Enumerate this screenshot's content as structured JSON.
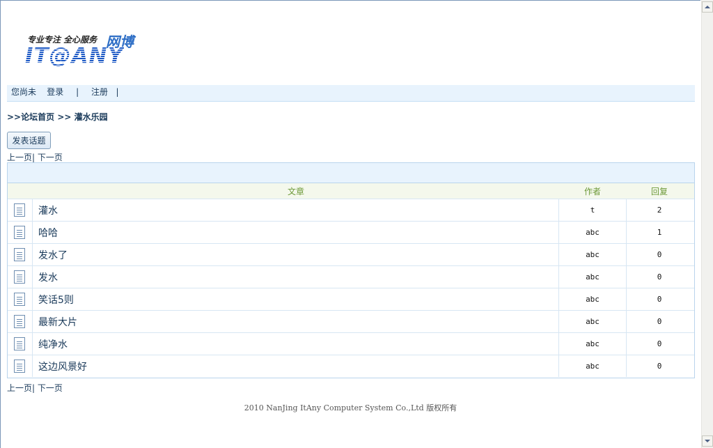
{
  "header": {
    "slogan": "专业专注  全心服务",
    "slogan_brand_cn": "网博",
    "brand": "IT@ANY"
  },
  "userbar": {
    "status": "您尚未",
    "login": "登录",
    "register": "注册"
  },
  "breadcrumb": {
    "home": ">>论坛首页",
    "current": ">> 灌水乐园"
  },
  "toolbar": {
    "post_button": "发表话题"
  },
  "pager": {
    "prev": "上一页",
    "next": "下一页"
  },
  "table": {
    "columns": [
      "文章",
      "作者",
      "回复"
    ],
    "rows": [
      {
        "title": "灌水",
        "author": "t",
        "replies": "2"
      },
      {
        "title": "哈哈",
        "author": "abc",
        "replies": "1"
      },
      {
        "title": "发水了",
        "author": "abc",
        "replies": "0"
      },
      {
        "title": "发水",
        "author": "abc",
        "replies": "0"
      },
      {
        "title": "笑话5则",
        "author": "abc",
        "replies": "0"
      },
      {
        "title": "最新大片",
        "author": "abc",
        "replies": "0"
      },
      {
        "title": "纯净水",
        "author": "abc",
        "replies": "0"
      },
      {
        "title": "这边风景好",
        "author": "abc",
        "replies": "0"
      }
    ]
  },
  "footer": {
    "copyright": "2010 NanJing ItAny Computer System Co.,Ltd 版权所有"
  },
  "colors": {
    "accent": "#1a57c4",
    "header_bg": "#e8f3fd",
    "column_header_text": "#6e9a3a"
  },
  "icons": {
    "thread": "document-icon",
    "scroll_up": "arrow-up-icon",
    "scroll_down": "arrow-down-icon"
  }
}
